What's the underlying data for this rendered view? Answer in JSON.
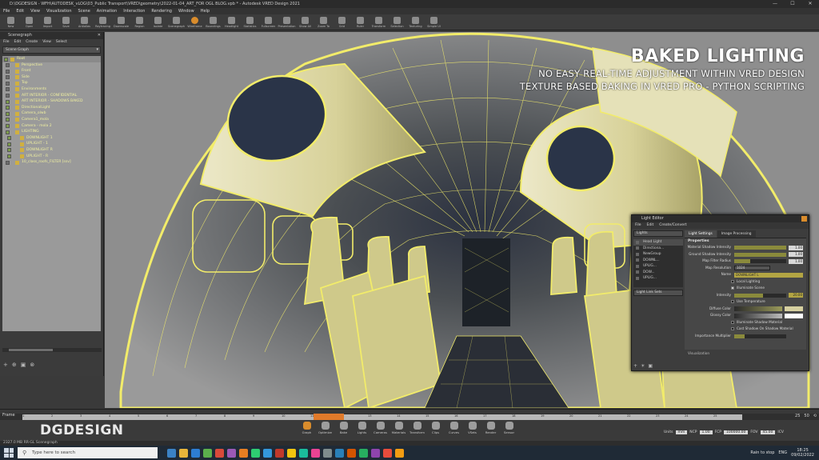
{
  "window": {
    "title": "D:\\DGDESIGN - WFH\\AUTODESK_vLOG\\03_Public Transport\\VRED\\geometry\\2022-01-04_ART_FOR OGL BLOG.vpb * - Autodesk VRED Design 2021"
  },
  "menu": [
    "File",
    "Edit",
    "View",
    "Visualization",
    "Scene",
    "Animation",
    "Interaction",
    "Rendering",
    "Window",
    "Help"
  ],
  "toolbar": [
    "New",
    "Open",
    "Import",
    "Save",
    "Antialias",
    "Raytracing",
    "Downscale",
    "Region",
    "Isolate",
    "Scenegraph",
    "Wireframe",
    "Boundings",
    "Headlight",
    "Statistics",
    "Fullscreen",
    "Presentation",
    "Show All",
    "Zoom To",
    "Grid",
    "Ruler",
    "Transform",
    "Selection",
    "Texturing",
    "Simple UI"
  ],
  "scenegraph": {
    "title": "Scenegraph",
    "menu": [
      "File",
      "Edit",
      "Create",
      "View",
      "Select"
    ],
    "combo": "Scene Graph",
    "nodes": [
      {
        "label": "Root",
        "depth": 0,
        "chk": true
      },
      {
        "label": "Perspective",
        "depth": 1,
        "chk": false
      },
      {
        "label": "Front",
        "depth": 1,
        "chk": false
      },
      {
        "label": "Side",
        "depth": 1,
        "chk": false
      },
      {
        "label": "Top",
        "depth": 1,
        "chk": false
      },
      {
        "label": "Environments",
        "depth": 1,
        "chk": false
      },
      {
        "label": "ART INTERIOR - CONFIDENTIAL",
        "depth": 1,
        "chk": false
      },
      {
        "label": "ART INTERIOR - SHADOWS BAKED",
        "depth": 1,
        "chk": true
      },
      {
        "label": "DirectionalLight",
        "depth": 1,
        "chk": true
      },
      {
        "label": "Camera_olwb",
        "depth": 1,
        "chk": true
      },
      {
        "label": "Camera1_mola",
        "depth": 1,
        "chk": true
      },
      {
        "label": "Camera - mola 2",
        "depth": 1,
        "chk": true
      },
      {
        "label": "LIGHTING",
        "depth": 1,
        "chk": true
      },
      {
        "label": "DOWNLIGHT 1",
        "depth": 2,
        "chk": true
      },
      {
        "label": "UPLIGHT - 1",
        "depth": 2,
        "chk": true
      },
      {
        "label": "DOWNLIGHT R",
        "depth": 2,
        "chk": true
      },
      {
        "label": "UPLIGHT - R",
        "depth": 2,
        "chk": true
      },
      {
        "label": "10_class_roofs_FILTER [ssv]",
        "depth": 1,
        "chk": false
      }
    ]
  },
  "overlay": {
    "title": "BAKED LIGHTING",
    "line1": "NO EASY REAL-TIME ADJUSTMENT WITHIN VRED DESIGN",
    "line2": "TEXTURE BASED BAKING IN VRED PRO - PYTHON SCRIPTING"
  },
  "light_editor": {
    "title": "Light Editor",
    "menu": [
      "File",
      "Edit",
      "Create/Convert"
    ],
    "combo": "Lights",
    "items": [
      "Head Light",
      "Directiona...",
      "NewGroup",
      "DOWNL...",
      "UPLIG...",
      "DOW...",
      "UPLIG..."
    ],
    "link_combo": "Light Link Sets",
    "tabs": [
      "Light Settings",
      "Image Processing"
    ],
    "section": "Properties",
    "props": {
      "mat_shadow": "Material Shadow Intensity",
      "mat_shadow_v": "1.00",
      "ground_shadow": "Ground Shadow Intensity",
      "ground_shadow_v": "1.00",
      "map_filter": "Map Filter Radius",
      "map_filter_v": "1.00",
      "map_res": "Map Resolution",
      "map_res_v": "1024",
      "name": "Name",
      "name_v": "DOWNLIGHT L",
      "local": "Local Lighting",
      "illum": "Illuminate Scene",
      "intensity": "Intensity",
      "intensity_v": "20.00",
      "use_temp": "Use Temperature",
      "diffuse": "Diffuse Color",
      "glossy": "Glossy Color",
      "illum_shadow": "Illuminate Shadow Material",
      "cast_shadow": "Cast Shadow On Shadow Material",
      "importance": "Importance Multiplier",
      "visualization": "Visualization"
    }
  },
  "timeline": {
    "label": "Frame",
    "ticks": [
      "1",
      "2",
      "3",
      "4",
      "5",
      "6",
      "7",
      "8",
      "9",
      "10",
      "11",
      "12",
      "13",
      "14",
      "15",
      "16",
      "17",
      "18",
      "19",
      "20",
      "21",
      "22",
      "23",
      "24",
      "25"
    ],
    "current": "25",
    "fps": "25",
    "end": "50"
  },
  "bottom": {
    "logo": "DGDESIGN",
    "modules": [
      "Graph",
      "Optimize",
      "Bake",
      "Lights",
      "Cameras",
      "Materials",
      "Transform",
      "Clips",
      "Curves",
      "VSets",
      "Render",
      "Sensor"
    ],
    "units": "mm",
    "ncp": "NCP",
    "ncp_v": "1.00",
    "fcp": "FCP",
    "fcp_v": "100000.00",
    "fov": "FOV",
    "fov_v": "45.00",
    "icv": "ICV"
  },
  "status": "2327.0 MB  RR-GL  Scenegraph",
  "taskbar": {
    "search": "Type here to search",
    "weather": "Rain to stop",
    "lang": "ENG",
    "time": "18:25",
    "date": "09/02/2022"
  },
  "colors": {
    "wire": "#f2ec6a",
    "accent": "#d98c2c",
    "panel": "#3b3b3b"
  }
}
